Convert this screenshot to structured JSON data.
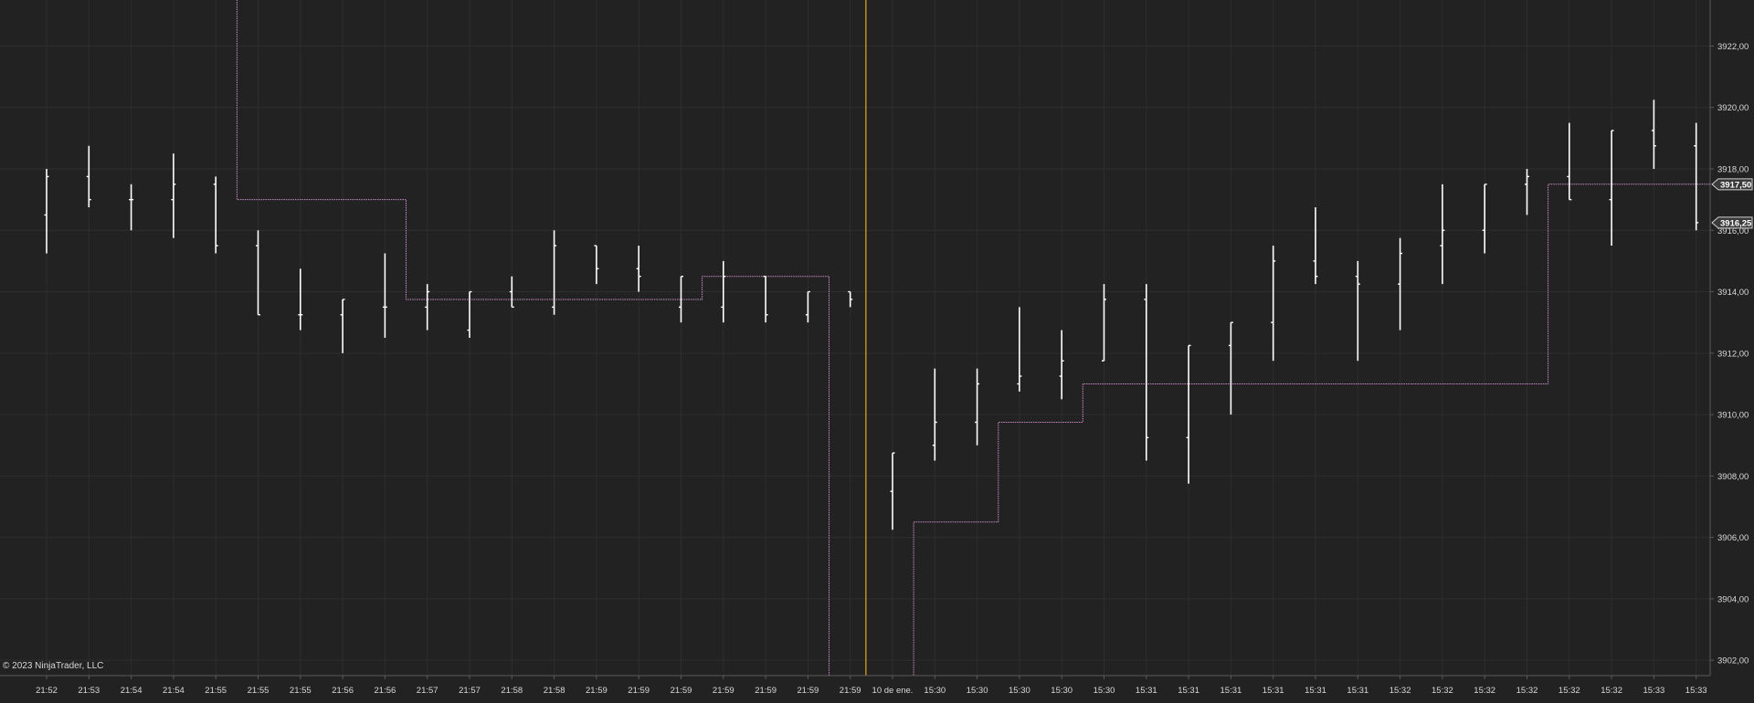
{
  "copyright": "© 2023 NinjaTrader, LLC",
  "colors": {
    "background": "#222222",
    "grid": "#2e2e2e",
    "bar": "#ffffff",
    "step_line": "#c88ac8",
    "cursor_line": "#d4a017",
    "axis_text": "#d8d8d8",
    "axis_line": "#5a5a5a",
    "price_tag_bg": "#3a3a3a"
  },
  "chart_data": {
    "type": "ohlc",
    "grid": true,
    "ylim": [
      3901.5,
      3923.5
    ],
    "ytick_values": [
      3902,
      3904,
      3906,
      3908,
      3910,
      3912,
      3914,
      3916,
      3918,
      3920,
      3922
    ],
    "ytick_labels": [
      "3902,00",
      "3904,00",
      "3906,00",
      "3908,00",
      "3910,00",
      "3912,00",
      "3914,00",
      "3916,00",
      "3918,00",
      "3920,00",
      "3922,00"
    ],
    "x_labels": [
      "21:52",
      "21:53",
      "21:54",
      "21:54",
      "21:55",
      "21:55",
      "21:55",
      "21:56",
      "21:56",
      "21:57",
      "21:57",
      "21:58",
      "21:58",
      "21:59",
      "21:59",
      "21:59",
      "21:59",
      "21:59",
      "21:59",
      "21:59",
      "10 de ene.",
      "15:30",
      "15:30",
      "15:30",
      "15:30",
      "15:30",
      "15:31",
      "15:31",
      "15:31",
      "15:31",
      "15:31",
      "15:31",
      "15:32",
      "15:32",
      "15:32",
      "15:32",
      "15:32",
      "15:32",
      "15:33",
      "15:33"
    ],
    "price_tags": [
      {
        "label": "3917,50",
        "value": 3917.5
      },
      {
        "label": "3916,25",
        "value": 3916.25
      }
    ],
    "cursor_index": 19.5,
    "bars": [
      {
        "o": 3916.5,
        "h": 3918.0,
        "l": 3915.25,
        "c": 3917.75
      },
      {
        "o": 3917.75,
        "h": 3918.75,
        "l": 3916.75,
        "c": 3917.0
      },
      {
        "o": 3917.0,
        "h": 3917.5,
        "l": 3916.0,
        "c": 3917.0
      },
      {
        "o": 3917.0,
        "h": 3918.5,
        "l": 3915.75,
        "c": 3917.5
      },
      {
        "o": 3917.5,
        "h": 3917.75,
        "l": 3915.25,
        "c": 3915.5
      },
      {
        "o": 3915.5,
        "h": 3916.0,
        "l": 3913.25,
        "c": 3913.25
      },
      {
        "o": 3913.25,
        "h": 3914.75,
        "l": 3912.75,
        "c": 3913.25
      },
      {
        "o": 3913.25,
        "h": 3913.75,
        "l": 3912.0,
        "c": 3913.75
      },
      {
        "o": 3913.5,
        "h": 3915.25,
        "l": 3912.5,
        "c": 3913.5
      },
      {
        "o": 3913.5,
        "h": 3914.25,
        "l": 3912.75,
        "c": 3914.0
      },
      {
        "o": 3912.75,
        "h": 3914.0,
        "l": 3912.5,
        "c": 3914.0
      },
      {
        "o": 3914.0,
        "h": 3914.5,
        "l": 3913.5,
        "c": 3913.5
      },
      {
        "o": 3913.5,
        "h": 3916.0,
        "l": 3913.25,
        "c": 3915.5
      },
      {
        "o": 3915.5,
        "h": 3915.5,
        "l": 3914.25,
        "c": 3914.75
      },
      {
        "o": 3914.75,
        "h": 3915.5,
        "l": 3914.0,
        "c": 3914.5
      },
      {
        "o": 3913.5,
        "h": 3914.5,
        "l": 3913.0,
        "c": 3914.5
      },
      {
        "o": 3913.5,
        "h": 3915.0,
        "l": 3913.0,
        "c": 3914.5
      },
      {
        "o": 3914.5,
        "h": 3914.5,
        "l": 3913.0,
        "c": 3913.25
      },
      {
        "o": 3913.25,
        "h": 3914.0,
        "l": 3913.0,
        "c": 3914.0
      },
      {
        "o": 3914.0,
        "h": 3914.0,
        "l": 3913.5,
        "c": 3913.75
      },
      {
        "o": 3907.5,
        "h": 3908.75,
        "l": 3906.25,
        "c": 3908.75
      },
      {
        "o": 3909.0,
        "h": 3911.5,
        "l": 3908.5,
        "c": 3909.75
      },
      {
        "o": 3909.75,
        "h": 3911.5,
        "l": 3909.0,
        "c": 3911.0
      },
      {
        "o": 3911.0,
        "h": 3913.5,
        "l": 3910.75,
        "c": 3911.25
      },
      {
        "o": 3911.25,
        "h": 3912.75,
        "l": 3910.5,
        "c": 3911.75
      },
      {
        "o": 3911.75,
        "h": 3914.25,
        "l": 3911.75,
        "c": 3913.75
      },
      {
        "o": 3913.75,
        "h": 3914.25,
        "l": 3908.5,
        "c": 3909.25
      },
      {
        "o": 3909.25,
        "h": 3912.25,
        "l": 3907.75,
        "c": 3912.25
      },
      {
        "o": 3912.25,
        "h": 3913.0,
        "l": 3910.0,
        "c": 3913.0
      },
      {
        "o": 3913.0,
        "h": 3915.5,
        "l": 3911.75,
        "c": 3915.0
      },
      {
        "o": 3915.0,
        "h": 3916.75,
        "l": 3914.25,
        "c": 3914.5
      },
      {
        "o": 3914.5,
        "h": 3915.0,
        "l": 3911.75,
        "c": 3914.25
      },
      {
        "o": 3914.25,
        "h": 3915.75,
        "l": 3912.75,
        "c": 3915.25
      },
      {
        "o": 3915.5,
        "h": 3917.5,
        "l": 3914.25,
        "c": 3916.0
      },
      {
        "o": 3916.0,
        "h": 3917.5,
        "l": 3915.25,
        "c": 3917.5
      },
      {
        "o": 3917.5,
        "h": 3918.0,
        "l": 3916.5,
        "c": 3917.75
      },
      {
        "o": 3917.75,
        "h": 3919.5,
        "l": 3917.0,
        "c": 3917.0
      },
      {
        "o": 3917.0,
        "h": 3919.25,
        "l": 3915.5,
        "c": 3919.25
      },
      {
        "o": 3919.25,
        "h": 3920.25,
        "l": 3918.0,
        "c": 3918.75
      },
      {
        "o": 3918.75,
        "h": 3919.5,
        "l": 3916.0,
        "c": 3916.25
      }
    ],
    "step_line": {
      "x": [
        0,
        4.5,
        4.5,
        8.5,
        8.5,
        15.5,
        15.5,
        18.5,
        18.5,
        20.5,
        20.5,
        22.5,
        22.5,
        24.5,
        24.5,
        35.5,
        35.5,
        40.0
      ],
      "y": [
        3926,
        3926,
        3917.0,
        3917.0,
        3913.75,
        3913.75,
        3914.5,
        3914.5,
        3901.0,
        3901.0,
        3906.5,
        3906.5,
        3909.75,
        3909.75,
        3911.0,
        3911.0,
        3917.5,
        3917.5
      ]
    }
  }
}
